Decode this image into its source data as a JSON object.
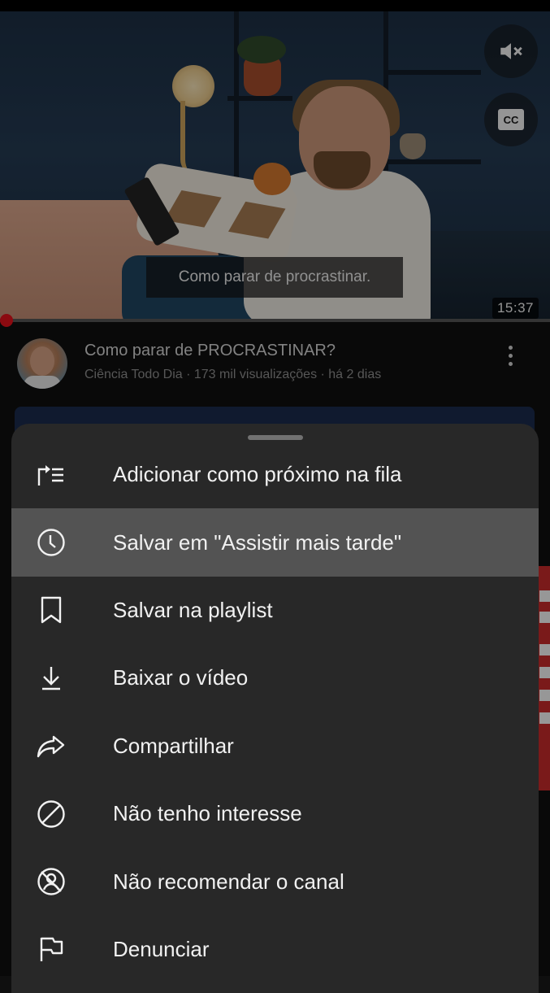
{
  "video": {
    "caption": "Como parar de procrastinar.",
    "duration": "15:37",
    "mute_icon": "volume-off-icon",
    "cc_icon": "closed-captions-icon",
    "cc_label": "CC"
  },
  "info": {
    "title": "Como parar de PROCRASTINAR?",
    "meta": "Ciência Todo Dia · 173 mil visualizações · há 2 dias"
  },
  "menu": {
    "items": [
      {
        "label": "Adicionar como próximo na fila",
        "icon": "play-next-queue-icon"
      },
      {
        "label": "Salvar em \"Assistir mais tarde\"",
        "icon": "clock-icon",
        "active": true
      },
      {
        "label": "Salvar na playlist",
        "icon": "bookmark-icon"
      },
      {
        "label": "Baixar o vídeo",
        "icon": "download-icon"
      },
      {
        "label": "Compartilhar",
        "icon": "share-icon"
      },
      {
        "label": "Não tenho interesse",
        "icon": "not-interested-icon"
      },
      {
        "label": "Não recomendar o canal",
        "icon": "block-channel-icon"
      },
      {
        "label": "Denunciar",
        "icon": "flag-icon"
      }
    ]
  },
  "colors": {
    "sheet_background": "#282828",
    "active_row": "#535353",
    "progress_accent": "#e0111a"
  }
}
